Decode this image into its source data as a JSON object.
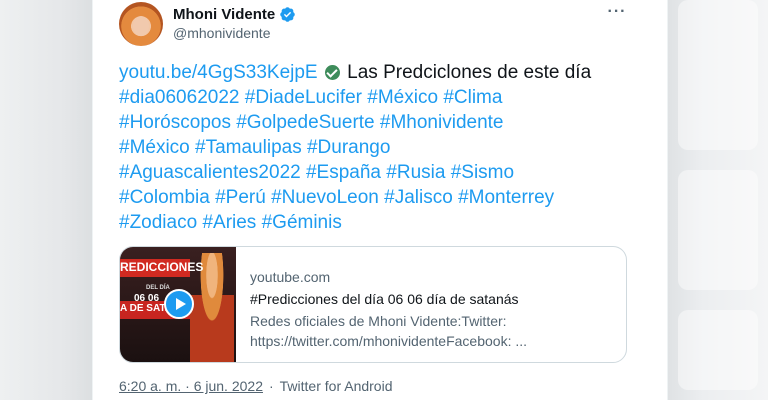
{
  "author": {
    "name": "Mhoni Vidente",
    "handle": "@mhonividente"
  },
  "tweet": {
    "link_text": "youtu.be/4GgS33KejpE",
    "lead_text": "Las Predciclones de este día",
    "lines": [
      [
        "#dia06062022",
        "#DiadeLucifer",
        "#México",
        "#Clima"
      ],
      [
        "#Horóscopos",
        "#GolpedeSuerte",
        "#Mhonividente"
      ],
      [
        "#México",
        "#Tamaulipas",
        "#Durango"
      ],
      [
        "#Aguascalientes2022",
        "#España",
        "#Rusia",
        "#Sismo"
      ],
      [
        "#Colombia",
        "#Perú",
        "#NuevoLeon",
        "#Jalisco",
        "#Monterrey"
      ],
      [
        "#Zodiaco",
        "#Aries",
        "#Géminis"
      ]
    ]
  },
  "preview": {
    "thumbnail_text": [
      "REDICCIONES",
      "DEL DÍA",
      "06 06",
      "A DE SATANÁS"
    ],
    "domain": "youtube.com",
    "title": "#Predicciones del día 06 06 día de satanás",
    "description_line1": "Redes oficiales de Mhoni Vidente:Twitter:",
    "description_line2": "https://twitter.com/mhonividenteFacebook: ..."
  },
  "meta": {
    "time": "6:20 a. m. · 6 jun. 2022",
    "source": "Twitter for Android"
  },
  "colors": {
    "accent": "#1d9bf0",
    "text": "#0f1419",
    "muted": "#536471"
  },
  "icons": [
    "verified-badge-icon",
    "more-options-icon",
    "check-emoji-icon",
    "play-icon"
  ]
}
